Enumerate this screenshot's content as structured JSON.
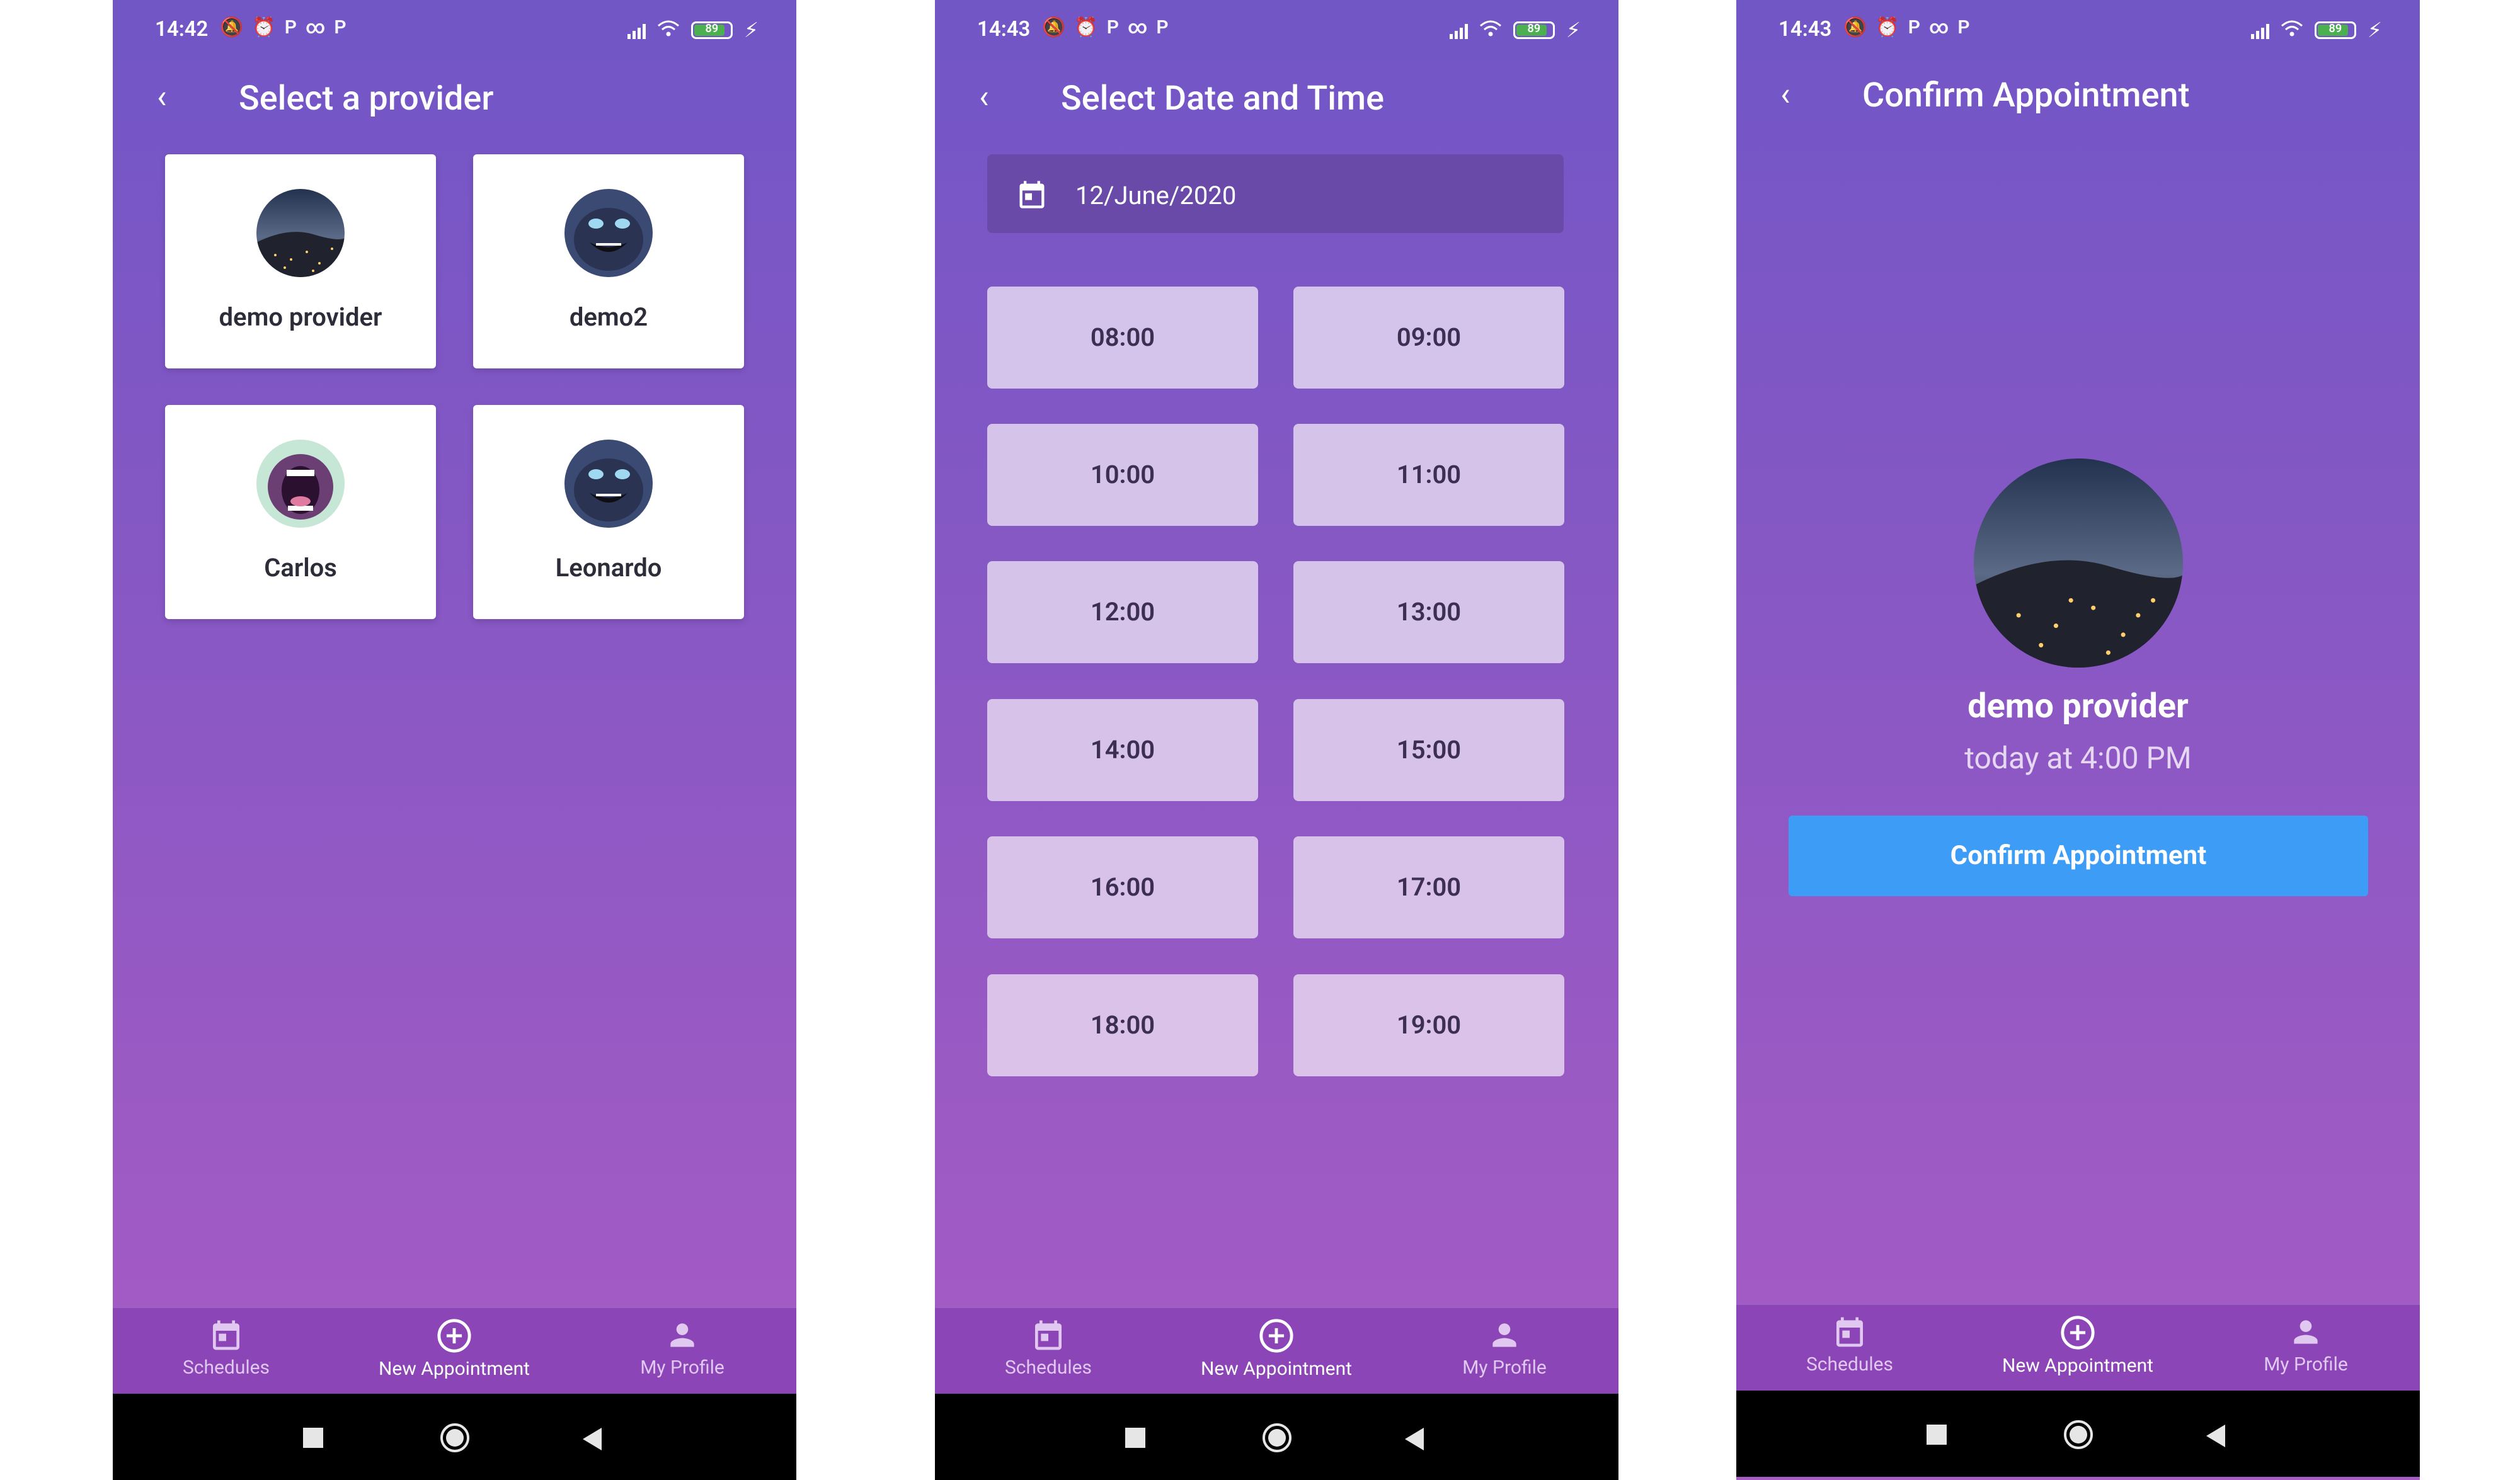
{
  "screens": [
    {
      "status_time": "14:42",
      "battery": "89",
      "title": "Select a provider",
      "providers": [
        {
          "name": "demo provider",
          "avatar": "night-city-avatar"
        },
        {
          "name": "demo2",
          "avatar": "cartoon-face-avatar"
        },
        {
          "name": "Carlos",
          "avatar": "screaming-cartoon-avatar"
        },
        {
          "name": "Leonardo",
          "avatar": "cartoon-face-avatar"
        }
      ]
    },
    {
      "status_time": "14:43",
      "battery": "89",
      "title": "Select Date and Time",
      "date": "12/June/2020",
      "slots": [
        "08:00",
        "09:00",
        "10:00",
        "11:00",
        "12:00",
        "13:00",
        "14:00",
        "15:00",
        "16:00",
        "17:00",
        "18:00",
        "19:00"
      ]
    },
    {
      "status_time": "14:43",
      "battery": "89",
      "title": "Confirm Appointment",
      "provider_name": "demo provider",
      "when": "today at 4:00 PM",
      "confirm_label": "Confirm Appointment"
    }
  ],
  "nav": {
    "schedules": "Schedules",
    "new_appointment": "New Appointment",
    "my_profile": "My Profile"
  },
  "colors": {
    "primary": "#7156c6",
    "accent_button": "#3d9cf5",
    "nav_bg": "#8b45b6",
    "slot_bg": "#d4c3ea"
  }
}
